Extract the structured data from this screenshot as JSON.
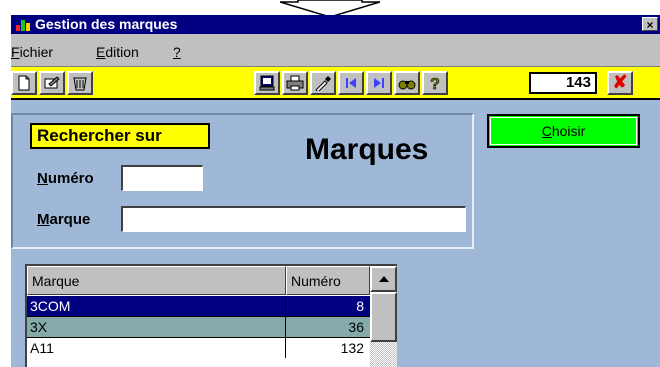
{
  "window": {
    "title": "Gestion des marques",
    "close_glyph": "×"
  },
  "menu": [
    {
      "label": "Fichier",
      "mnemonic": "F",
      "rest": "ichier"
    },
    {
      "label": "Edition",
      "mnemonic": "E",
      "rest": "dition"
    },
    {
      "label": "?",
      "mnemonic": "?",
      "rest": ""
    }
  ],
  "toolbar": {
    "left_icons": [
      "new-document-icon",
      "edit-icon",
      "trash-icon"
    ],
    "right_icons": [
      "monitor-icon",
      "print-icon",
      "pipette-icon",
      "first-record-icon",
      "last-record-icon",
      "binoculars-icon",
      "help-icon"
    ],
    "counter": "143",
    "cancel_glyph": "✘"
  },
  "search": {
    "label": "Rechercher sur",
    "numero_label": {
      "mnemonic": "N",
      "rest": "uméro"
    },
    "numero_value": "",
    "marque_label": {
      "mnemonic": "M",
      "rest": "arque"
    },
    "marque_value": ""
  },
  "page_title": "Marques",
  "choose_button": {
    "mnemonic": "C",
    "rest": "hoisir"
  },
  "list": {
    "columns": [
      "Marque",
      "Numéro"
    ],
    "rows": [
      {
        "marque": "3COM",
        "numero": "8",
        "state": "selected"
      },
      {
        "marque": "3X",
        "numero": "36",
        "state": "highlighted"
      },
      {
        "marque": "A11",
        "numero": "132",
        "state": "normal"
      }
    ]
  },
  "colors": {
    "titlebar": "#000080",
    "toolbar": "#ffff00",
    "content_background": "#9fb8d8",
    "choose_button": "#00ff00",
    "selected_row": "#000080",
    "highlighted_row": "#85aaaa"
  }
}
